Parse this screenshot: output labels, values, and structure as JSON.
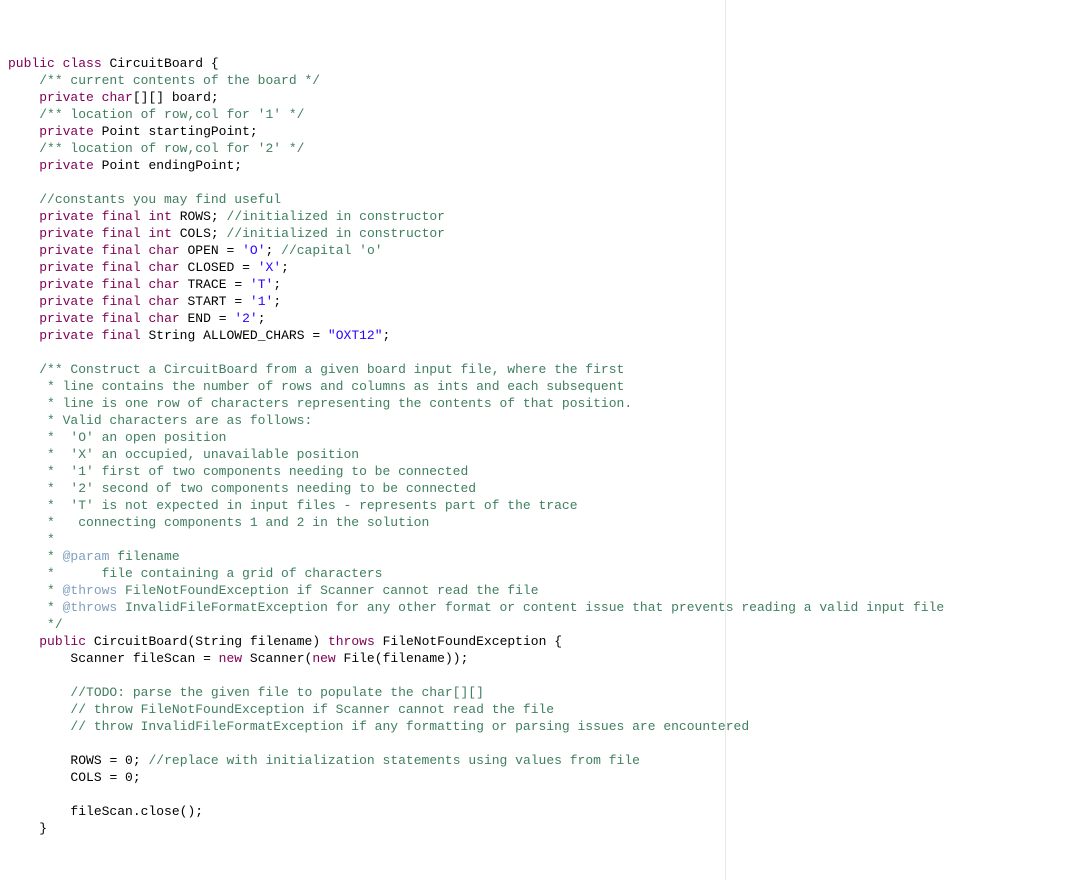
{
  "l1": {
    "kw1": "public",
    "kw2": "class",
    "id": "CircuitBoard",
    "brace": "{"
  },
  "l2": {
    "cm": "/** current contents of the board */"
  },
  "l3": {
    "kw1": "private",
    "kw2": "char",
    "id": "board",
    "rest": "[][] ",
    "semi": ";"
  },
  "l4": {
    "cm": "/** location of row,col for '1' */"
  },
  "l5": {
    "kw1": "private",
    "ty": "Point",
    "id": "startingPoint",
    "semi": ";"
  },
  "l6": {
    "cm": "/** location of row,col for '2' */"
  },
  "l7": {
    "kw1": "private",
    "ty": "Point",
    "id": "endingPoint",
    "semi": ";"
  },
  "l9": {
    "cm": "//constants you may find useful"
  },
  "l10": {
    "kw1": "private",
    "kw2": "final",
    "kw3": "int",
    "id": "ROWS",
    "semi": ";",
    "cm": "//initialized in constructor"
  },
  "l11": {
    "kw1": "private",
    "kw2": "final",
    "kw3": "int",
    "id": "COLS",
    "semi": ";",
    "cm": "//initialized in constructor"
  },
  "l12": {
    "kw1": "private",
    "kw2": "final",
    "kw3": "char",
    "id": "OPEN",
    "eq": " = ",
    "ch": "'O'",
    "semi": ";",
    "cm": "//capital 'o'"
  },
  "l13": {
    "kw1": "private",
    "kw2": "final",
    "kw3": "char",
    "id": "CLOSED",
    "eq": " = ",
    "ch": "'X'",
    "semi": ";"
  },
  "l14": {
    "kw1": "private",
    "kw2": "final",
    "kw3": "char",
    "id": "TRACE",
    "eq": " = ",
    "ch": "'T'",
    "semi": ";"
  },
  "l15": {
    "kw1": "private",
    "kw2": "final",
    "kw3": "char",
    "id": "START",
    "eq": " = ",
    "ch": "'1'",
    "semi": ";"
  },
  "l16": {
    "kw1": "private",
    "kw2": "final",
    "kw3": "char",
    "id": "END",
    "eq": " = ",
    "ch": "'2'",
    "semi": ";"
  },
  "l17": {
    "kw1": "private",
    "kw2": "final",
    "ty": "String",
    "id": "ALLOWED_CHARS",
    "eq": " = ",
    "str": "\"OXT12\"",
    "semi": ";"
  },
  "c1": "/** Construct a CircuitBoard from a given board input file, where the first",
  "c2": " * line contains the number of rows and columns as ints and each subsequent",
  "c3": " * line is one row of characters representing the contents of that position.",
  "c4": " * Valid characters are as follows:",
  "c5": " *  'O' an open position",
  "c6": " *  'X' an occupied, unavailable position",
  "c7": " *  '1' first of two components needing to be connected",
  "c8": " *  '2' second of two components needing to be connected",
  "c9": " *  'T' is not expected in input files - represents part of the trace",
  "c10": " *   connecting components 1 and 2 in the solution",
  "c11": " * ",
  "c12_pre": " * ",
  "c12_tag": "@param",
  "c12_rest": " filename",
  "c13": " *      file containing a grid of characters",
  "c14_pre": " * ",
  "c14_tag": "@throws",
  "c14_rest": " FileNotFoundException if Scanner cannot read the file",
  "c15_pre": " * ",
  "c15_tag": "@throws",
  "c15_rest": " InvalidFileFormatException for any other format or content issue that prevents reading a valid input file",
  "c16": " */",
  "ctor": {
    "kw": "public",
    "name": "CircuitBoard",
    "p_ty": "String",
    "p_id": "filename",
    "throws": "throws",
    "ex": "FileNotFoundException",
    "brace": "{"
  },
  "sc": {
    "ty": "Scanner",
    "id": "fileScan",
    "eq": " = ",
    "new1": "new",
    "cls1": "Scanner",
    "new2": "new",
    "cls2": "File",
    "arg": "filename",
    "end": "));"
  },
  "t1": "//TODO: parse the given file to populate the char[][]",
  "t2": "// throw FileNotFoundException if Scanner cannot read the file",
  "t3": "// throw InvalidFileFormatException if any formatting or parsing issues are encountered",
  "r": {
    "id": "ROWS",
    "eq": " = ",
    "val": "0",
    "semi": ";",
    "cm": "//replace with initialization statements using values from file"
  },
  "c": {
    "id": "COLS",
    "eq": " = ",
    "val": "0",
    "semi": ";"
  },
  "close": {
    "obj": "fileScan",
    "call": ".close();"
  },
  "endBrace": "}"
}
